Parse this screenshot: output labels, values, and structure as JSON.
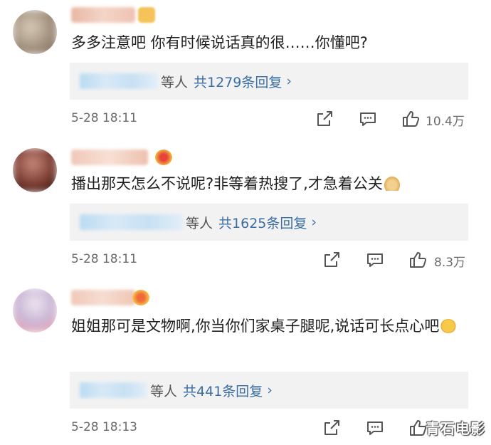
{
  "comments": [
    {
      "text": "多多注意吧 你有时候说话真的很……你懂吧?",
      "reply_others": "等人",
      "reply_count": "共1279条回复",
      "time": "5-28 18:11",
      "likes": "10.4万"
    },
    {
      "text": "播出那天怎么不说呢?非等着热搜了,才急着公关",
      "reply_others": "等人",
      "reply_count": "共1625条回复",
      "time": "5-28 18:11",
      "likes": "8.3万"
    },
    {
      "text": "姐姐那可是文物啊,你当你们家桌子腿呢,说话可长点心吧",
      "reply_others": "等人",
      "reply_count": "共441条回复",
      "time": "5-28 18:13",
      "likes": ""
    }
  ],
  "icons": {
    "reply_chevron": "chevron-right-icon",
    "share": "share-icon",
    "comment": "comment-icon",
    "like": "thumbs-up-icon"
  },
  "colors": {
    "link": "#3a6ea5",
    "reply_bg": "#f2f2f2",
    "meta": "#6b6b6b"
  },
  "watermark": "青石电影"
}
